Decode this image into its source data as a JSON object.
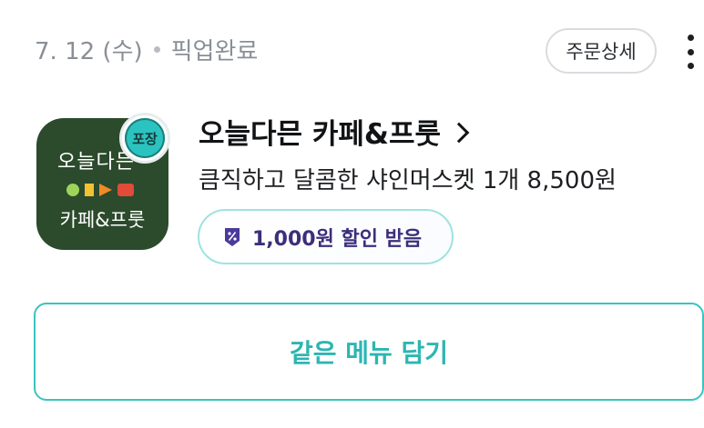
{
  "order": {
    "date": "7. 12 (수)",
    "status": "픽업완료",
    "detail_button": "주문상세",
    "more_icon": "more-vertical-icon"
  },
  "store": {
    "name": "오늘다믄 카페&프룻",
    "logo_line1": "오늘다믄",
    "logo_line2": "카페&프룻",
    "logo_olko_colors": [
      "#9ed35a",
      "#f2c230",
      "#f08a24",
      "#e04b3a"
    ],
    "pack_badge": "포장"
  },
  "item_summary": "큼직하고 달콤한 샤인머스켓 1개 8,500원",
  "coupon": {
    "label": "1,000원 할인 받음",
    "icon": "discount-tag-icon"
  },
  "actions": {
    "reorder_label": "같은 메뉴 담기"
  },
  "colors": {
    "accent": "#2cb6b2",
    "logo_bg": "#2c4a2c",
    "coupon_text": "#3c2e7a"
  }
}
